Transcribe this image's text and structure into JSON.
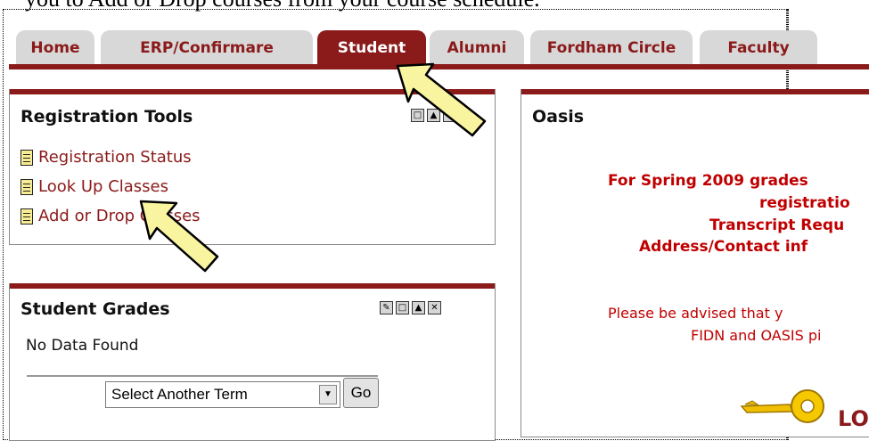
{
  "caption": "you to Add or Drop courses from your course schedule.",
  "tabs": [
    {
      "label": "Home"
    },
    {
      "label": "ERP/Confirmare"
    },
    {
      "label": "Student"
    },
    {
      "label": "Alumni"
    },
    {
      "label": "Fordham Circle"
    },
    {
      "label": "Faculty"
    }
  ],
  "registration_tools": {
    "title": "Registration Tools",
    "links": [
      {
        "label": "Registration Status"
      },
      {
        "label": "Look Up Classes"
      },
      {
        "label": "Add or Drop Classes"
      }
    ]
  },
  "student_grades": {
    "title": "Student Grades",
    "message": "No Data Found",
    "select_value": "Select Another Term",
    "go_label": "Go"
  },
  "oasis": {
    "title": "Oasis",
    "lines": [
      "For Spring 2009 grades",
      "registratio",
      "Transcript Requ",
      "Address/Contact inf"
    ],
    "note_lines": [
      "Please be advised that y",
      "FIDN and OASIS pi"
    ],
    "login_label": "LO"
  },
  "colors": {
    "accent": "#8b1a1a",
    "alert": "#c00000",
    "highlight_arrow": "#f8f4a0"
  }
}
